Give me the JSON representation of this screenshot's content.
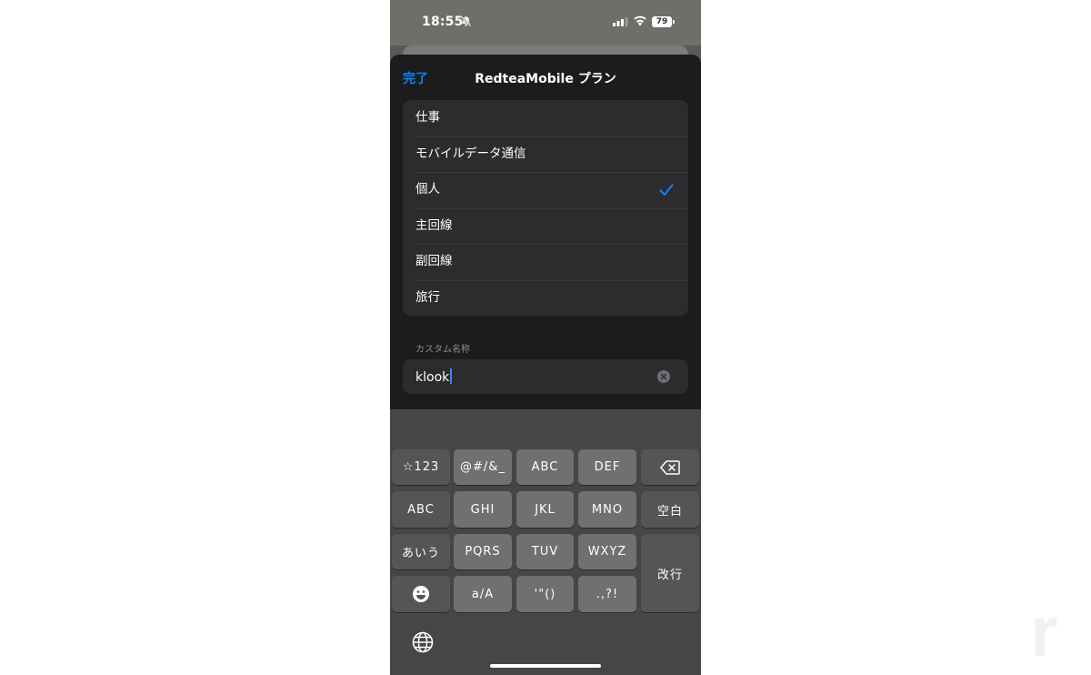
{
  "status_bar": {
    "time": "18:55",
    "battery": "79"
  },
  "sheet": {
    "done_label": "完了",
    "title": "RedteaMobile プラン",
    "options": [
      {
        "label": "仕事",
        "selected": false
      },
      {
        "label": "モバイルデータ通信",
        "selected": false
      },
      {
        "label": "個人",
        "selected": true
      },
      {
        "label": "主回線",
        "selected": false
      },
      {
        "label": "副回線",
        "selected": false
      },
      {
        "label": "旅行",
        "selected": false
      }
    ],
    "custom_name_label": "カスタム名称",
    "custom_name_value": "klook"
  },
  "keyboard": {
    "keys": {
      "symbols": "☆123",
      "punct": "@#/&_",
      "abc": "ABC",
      "def": "DEF",
      "mode_abc": "ABC",
      "ghi": "GHI",
      "jkl": "JKL",
      "mno": "MNO",
      "space": "空白",
      "kana": "あいう",
      "pqrs": "PQRS",
      "tuv": "TUV",
      "wxyz": "WXYZ",
      "return": "改行",
      "case": "a/A",
      "quotes": "'\"()",
      "dots": ".,?!"
    }
  },
  "watermark": "r",
  "colors": {
    "accent": "#0a84ff",
    "sheet_bg": "#1c1c1e",
    "cell_bg": "#2c2c2e"
  }
}
